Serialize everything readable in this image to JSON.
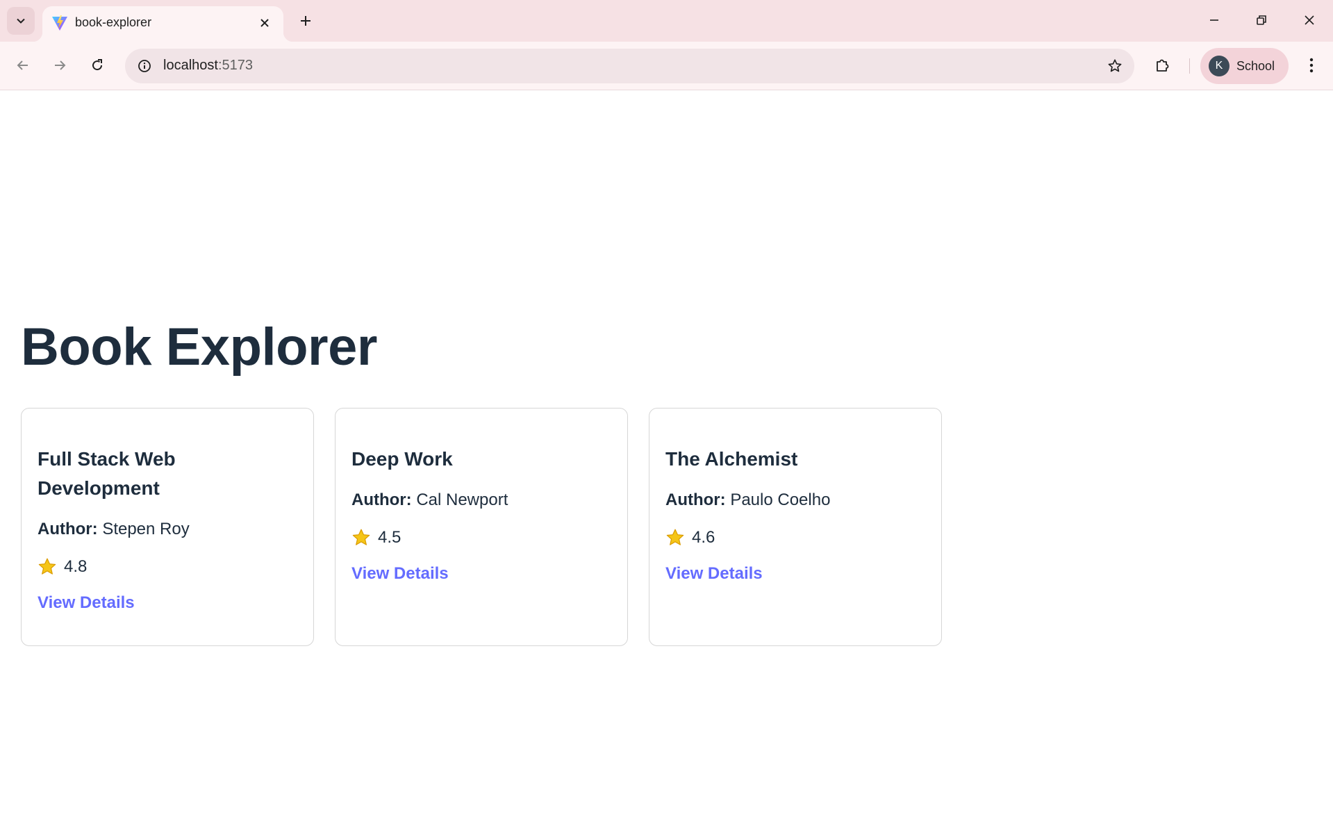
{
  "browser": {
    "tab_title": "book-explorer",
    "url_host": "localhost",
    "url_port": ":5173",
    "profile_initial": "K",
    "profile_label": "School"
  },
  "page": {
    "title": "Book Explorer",
    "author_label": "Author:",
    "link_label": "View Details",
    "accent_color": "#646cff",
    "star_color": "#f5c518",
    "books": [
      {
        "title": "Full Stack Web Development",
        "author": "Stepen Roy",
        "rating": "4.8"
      },
      {
        "title": "Deep Work",
        "author": "Cal Newport",
        "rating": "4.5"
      },
      {
        "title": "The Alchemist",
        "author": "Paulo Coelho",
        "rating": "4.6"
      }
    ]
  }
}
